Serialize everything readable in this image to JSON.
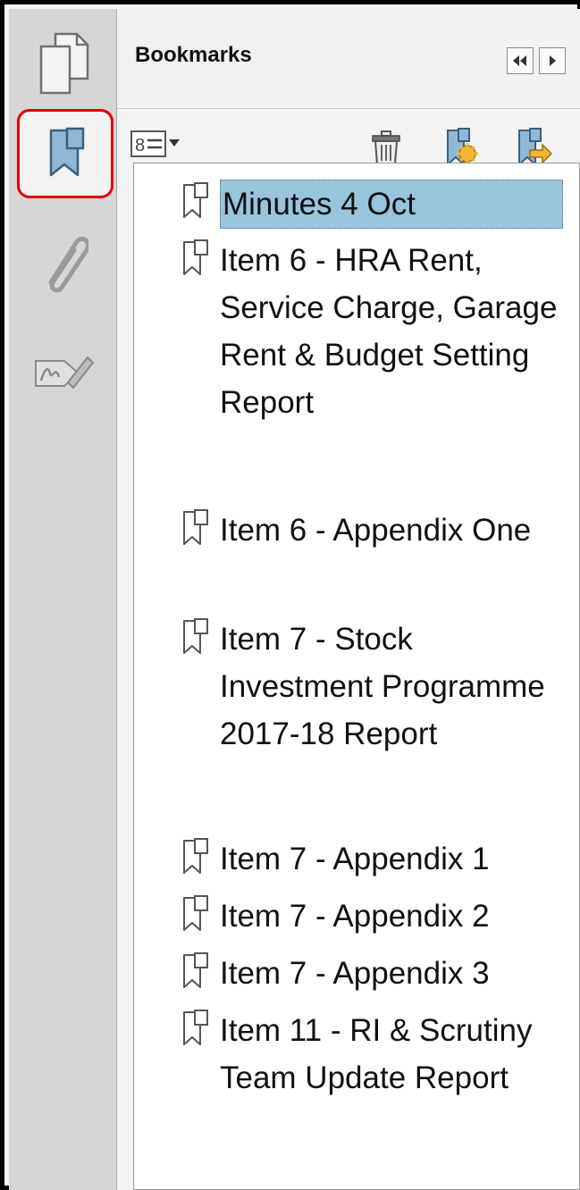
{
  "panel": {
    "title": "Bookmarks"
  },
  "rail": {
    "items": [
      {
        "name": "pages",
        "icon": "pages-icon",
        "active": false
      },
      {
        "name": "bookmarks",
        "icon": "bookmark-icon",
        "active": true
      },
      {
        "name": "attachments",
        "icon": "paperclip-icon",
        "active": false
      },
      {
        "name": "signatures",
        "icon": "signature-icon",
        "active": false
      }
    ]
  },
  "toolbar": {
    "options_icon": "options-menu-icon",
    "delete_icon": "trash-icon",
    "new_bookmark_icon": "new-bookmark-icon",
    "expand_bookmark_icon": "expand-bookmark-icon"
  },
  "colors": {
    "selection": "#99c4de",
    "highlight_border": "#e00000",
    "bookmark_icon": "#8fb8d8"
  },
  "bookmarks": [
    {
      "label": "Minutes 4 Oct",
      "selected": true
    },
    {
      "label": "Item 6 - HRA Rent, Service Charge, Garage Rent & Budget Setting Report",
      "selected": false
    },
    {
      "label": "Item 6 - Appendix One",
      "selected": false
    },
    {
      "label": "Item 7 - Stock Investment Programme 2017-18 Report",
      "selected": false
    },
    {
      "label": "Item 7 - Appendix 1",
      "selected": false
    },
    {
      "label": "Item 7 - Appendix 2",
      "selected": false
    },
    {
      "label": "Item 7 - Appendix 3",
      "selected": false
    },
    {
      "label": "Item 11 - RI & Scrutiny Team Update Report",
      "selected": false
    }
  ]
}
